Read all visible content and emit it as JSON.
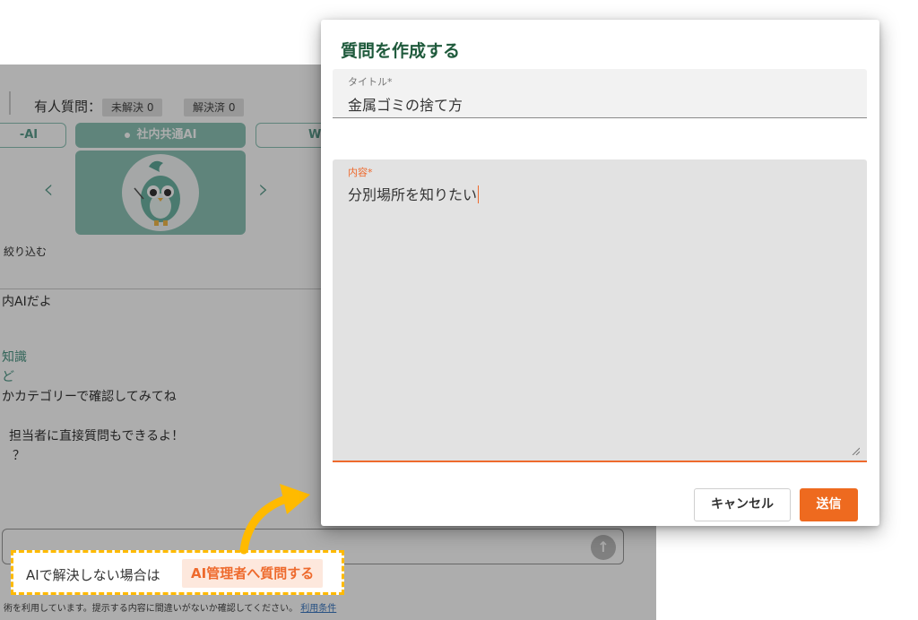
{
  "background": {
    "question_label": "有人質問：",
    "chips": [
      "未解決 0",
      "解決済 0"
    ],
    "tabs": [
      {
        "label": "-AI",
        "active": false
      },
      {
        "label": "社内共通AI",
        "active": true
      },
      {
        "label": "W",
        "active": false
      }
    ],
    "filter_label": "絞り込む",
    "chat_lines": [
      {
        "text": "内AIだよ",
        "teal": false
      },
      {
        "text": "知識",
        "teal": true
      },
      {
        "text": "ど",
        "teal": true
      },
      {
        "text": "かカテゴリーで確認してみてね",
        "teal": false
      },
      {
        "text": "担当者に直接質問もできるよ！",
        "teal": false
      },
      {
        "text": "？",
        "teal": false
      }
    ],
    "footer_text": "術を利用しています。提示する内容に間違いがないか確認してください。",
    "footer_link": "利用条件",
    "accent_color": "#8cc3b6"
  },
  "callout": {
    "text": "AIで解決しない場合は",
    "link": "AI管理者へ質問する",
    "border_color": "#ffba00"
  },
  "dialog": {
    "title": "質問を作成する",
    "title_field": {
      "label": "タイトル*",
      "value": "金属ゴミの捨て方"
    },
    "body_field": {
      "label": "内容*",
      "value": "分別場所を知りたい"
    },
    "cancel_label": "キャンセル",
    "submit_label": "送信",
    "accent_color": "#ee6a1f"
  }
}
